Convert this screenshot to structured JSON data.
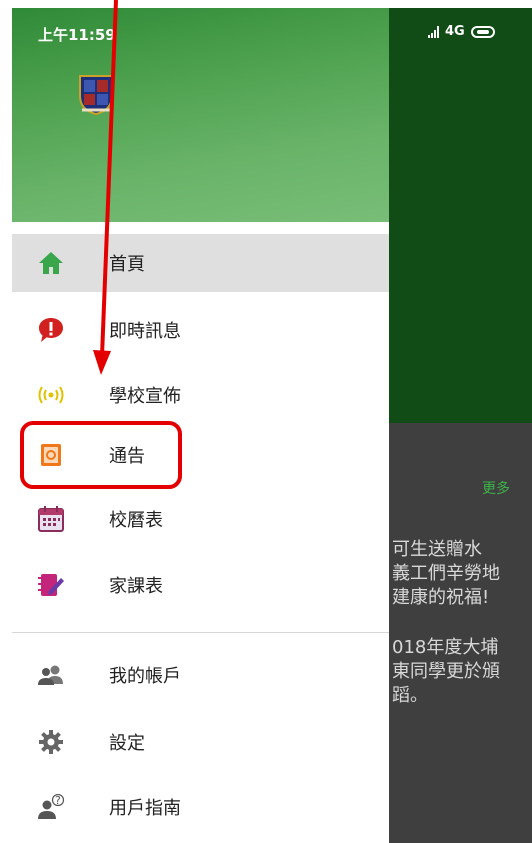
{
  "status_bar": {
    "time": "上午11:59",
    "network": "4G",
    "signal": "..ıl"
  },
  "sidebar": {
    "items": [
      {
        "label": "首頁",
        "icon": "home-icon",
        "active": true
      },
      {
        "label": "即時訊息",
        "icon": "message-alert-icon"
      },
      {
        "label": "學校宣佈",
        "icon": "broadcast-icon"
      },
      {
        "label": "通告",
        "icon": "notice-book-icon",
        "highlighted": true
      },
      {
        "label": "校曆表",
        "icon": "calendar-icon"
      },
      {
        "label": "家課表",
        "icon": "homework-edit-icon"
      },
      {
        "label": "我的帳戶",
        "icon": "account-users-icon"
      },
      {
        "label": "設定",
        "icon": "gear-icon"
      },
      {
        "label": "用戶指南",
        "icon": "user-guide-icon"
      }
    ]
  },
  "main": {
    "more_label": "更多",
    "news": [
      "可生送贈水\n義工們辛勞地\n建康的祝福!",
      "018年度大埔\n東同學更於頒\n蹈。"
    ]
  },
  "colors": {
    "drawer_header": "#4ea24f",
    "app_header": "#114c17",
    "annotation": "#e40000",
    "active_bg": "#dfdfdf"
  }
}
